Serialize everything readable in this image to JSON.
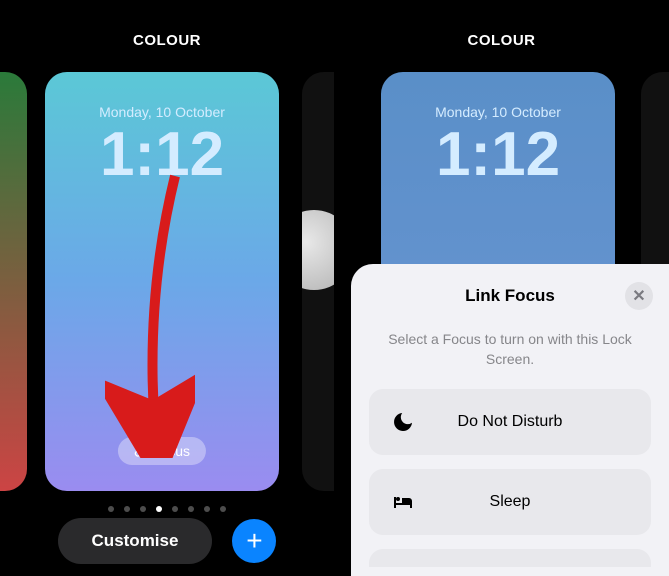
{
  "left": {
    "header": "COLOUR",
    "wallpaper": {
      "date": "Monday, 10 October",
      "time": "1:12",
      "focus_pill": "Focus"
    },
    "customise_label": "Customise",
    "page_dots": {
      "count": 8,
      "active_index": 3
    }
  },
  "right": {
    "header": "COLOUR",
    "wallpaper": {
      "date": "Monday, 10 October",
      "time": "1:12"
    },
    "sheet": {
      "title": "Link Focus",
      "subtitle": "Select a Focus to turn on with this Lock Screen.",
      "options": [
        {
          "name": "Do Not Disturb",
          "icon": "moon-icon"
        },
        {
          "name": "Sleep",
          "icon": "bed-icon"
        }
      ]
    }
  }
}
